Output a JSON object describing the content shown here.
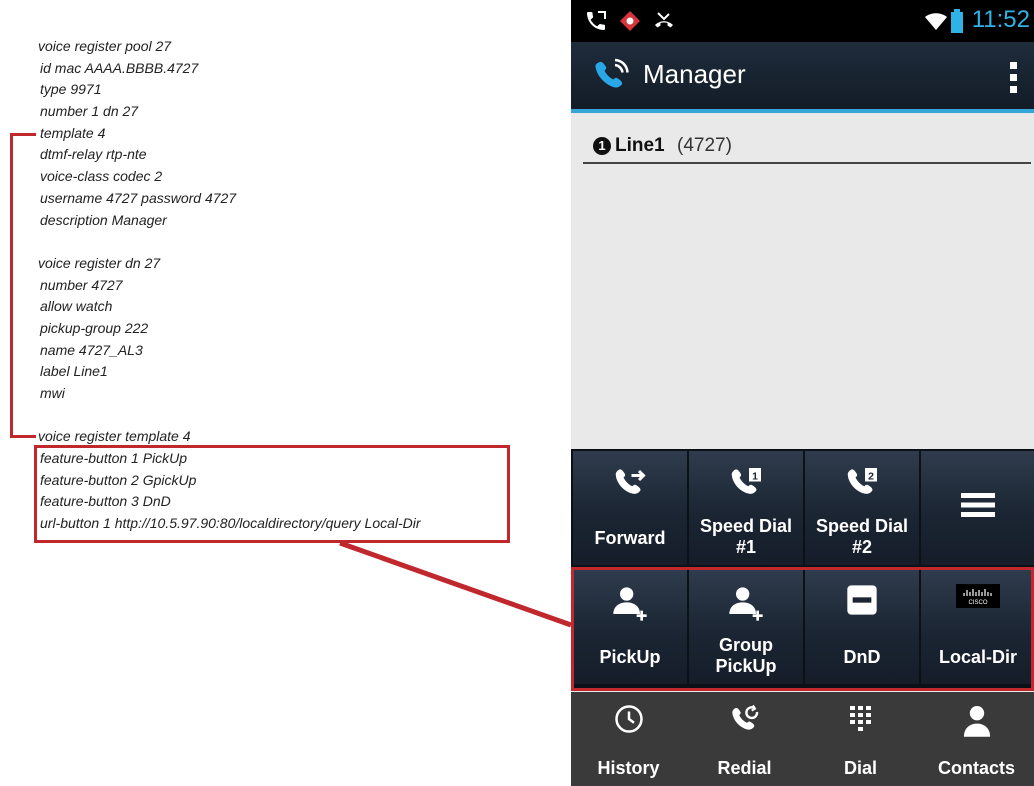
{
  "config": {
    "pool_lines": [
      "voice register pool  27",
      "id mac AAAA.BBBB.4727",
      "type 9971",
      "number 1 dn 27",
      "template 4",
      "dtmf-relay rtp-nte",
      "voice-class codec 2",
      "username 4727 password 4727",
      "description Manager"
    ],
    "dn_lines": [
      "voice register dn  27",
      "number 4727",
      "allow watch",
      "pickup-group 222",
      "name 4727_AL3",
      "label Line1",
      "mwi"
    ],
    "template_header": "voice register template  4",
    "template_lines": [
      "feature-button 1 PickUp",
      "feature-button 2 GpickUp",
      "feature-button 3 DnD",
      "url-button 1 http://10.5.97.90:80/localdirectory/query Local-Dir"
    ]
  },
  "phone": {
    "status": {
      "time": "11:52",
      "icons": [
        "phone-icon",
        "alert-icon",
        "missed-call-icon",
        "wifi-icon",
        "battery-icon"
      ]
    },
    "app_title": "Manager",
    "line": {
      "number": "1",
      "name": "Line1",
      "ext": "(4727)"
    },
    "feature_buttons": [
      {
        "label": "Forward",
        "icon": "call-forward-icon"
      },
      {
        "label": "Speed Dial #1",
        "icon": "speed-dial-1-icon"
      },
      {
        "label": "Speed Dial #2",
        "icon": "speed-dial-2-icon"
      },
      {
        "label": "",
        "icon": "menu-icon"
      },
      {
        "label": "PickUp",
        "icon": "pickup-icon"
      },
      {
        "label": "Group PickUp",
        "icon": "group-pickup-icon"
      },
      {
        "label": "DnD",
        "icon": "dnd-icon"
      },
      {
        "label": "Local-Dir",
        "icon": "cisco-logo-icon"
      }
    ],
    "nav": [
      {
        "label": "History",
        "icon": "clock-icon"
      },
      {
        "label": "Redial",
        "icon": "redial-icon"
      },
      {
        "label": "Dial",
        "icon": "dialpad-icon"
      },
      {
        "label": "Contacts",
        "icon": "contact-icon"
      }
    ],
    "colors": {
      "accent": "#35a6d8",
      "highlight": "#c0282d",
      "time": "#2fb3e6"
    }
  }
}
